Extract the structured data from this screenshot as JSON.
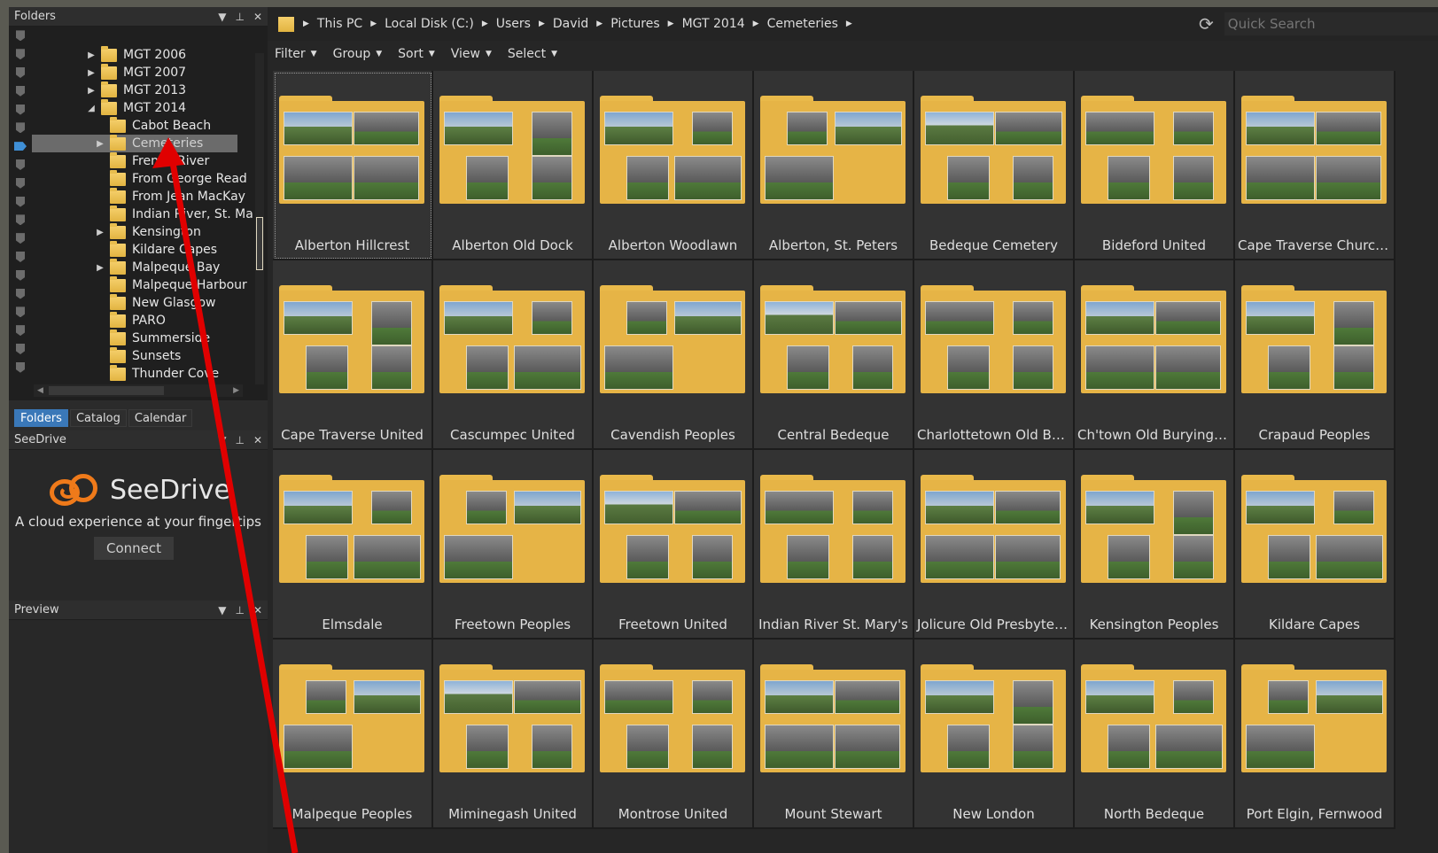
{
  "folders_panel": {
    "title": "Folders",
    "tree": [
      {
        "label": "MGT 2006",
        "expander": "▶"
      },
      {
        "label": "MGT 2007",
        "expander": "▶"
      },
      {
        "label": "MGT 2013",
        "expander": "▶"
      },
      {
        "label": "MGT 2014",
        "expander": "◢"
      },
      {
        "label": "Cabot Beach",
        "expander": ""
      },
      {
        "label": "Cemeteries",
        "expander": "▶"
      },
      {
        "label": "French River",
        "expander": ""
      },
      {
        "label": "From George Read",
        "expander": ""
      },
      {
        "label": "From Jean MacKay",
        "expander": ""
      },
      {
        "label": "Indian River, St. Ma",
        "expander": ""
      },
      {
        "label": "Kensington",
        "expander": "▶"
      },
      {
        "label": "Kildare Capes",
        "expander": ""
      },
      {
        "label": "Malpeque Bay",
        "expander": "▶"
      },
      {
        "label": "Malpeque Harbour",
        "expander": ""
      },
      {
        "label": "New Glasgow",
        "expander": ""
      },
      {
        "label": "PARO",
        "expander": ""
      },
      {
        "label": "Summerside",
        "expander": ""
      },
      {
        "label": "Sunsets",
        "expander": ""
      },
      {
        "label": "Thunder Cove",
        "expander": ""
      }
    ],
    "tabs": [
      "Folders",
      "Catalog",
      "Calendar"
    ]
  },
  "seedrive_panel": {
    "title": "SeeDrive",
    "brand": "SeeDrive",
    "tagline": "A cloud experience at your fingertips",
    "connect_label": "Connect"
  },
  "preview_panel": {
    "title": "Preview"
  },
  "address_bar": {
    "crumbs": [
      "This PC",
      "Local Disk (C:)",
      "Users",
      "David",
      "Pictures",
      "MGT 2014",
      "Cemeteries"
    ],
    "search_placeholder": "Quick Search"
  },
  "toolbar": {
    "items": [
      "Filter",
      "Group",
      "Sort",
      "View",
      "Select"
    ]
  },
  "grid": {
    "items": [
      "Alberton Hillcrest",
      "Alberton Old Dock",
      "Alberton Woodlawn",
      "Alberton, St. Peters",
      "Bedeque Cemetery",
      "Bideford United",
      "Cape Traverse Church of ...",
      "Cape Traverse United",
      "Cascumpec United",
      "Cavendish Peoples",
      "Central Bedeque",
      "Charlottetown Old Buryi...",
      "Ch'town Old Burying Gro...",
      "Crapaud Peoples",
      "Elmsdale",
      "Freetown Peoples",
      "Freetown United",
      "Indian River St. Mary's",
      "Jolicure Old Presbyterian",
      "Kensington Peoples",
      "Kildare Capes",
      "Malpeque Peoples",
      "Miminegash United",
      "Montrose United",
      "Mount Stewart",
      "New London",
      "North Bedeque",
      "Port Elgin, Fernwood"
    ]
  },
  "colors": {
    "accent": "#3a78b8",
    "folder": "#f3c85a",
    "annotation_arrow": "#e00000"
  }
}
